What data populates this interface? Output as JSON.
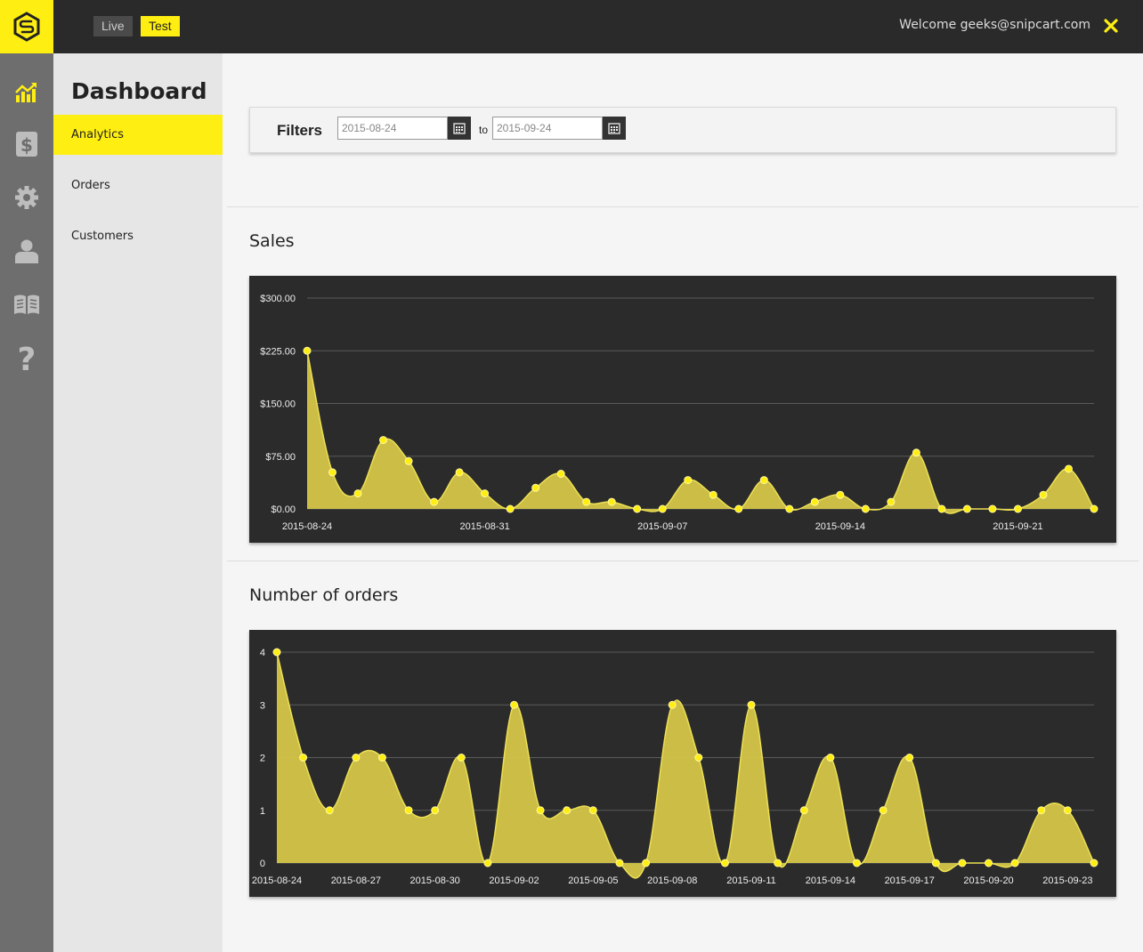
{
  "topbar": {
    "env_live": "Live",
    "env_test": "Test",
    "welcome": "Welcome geeks@snipcart.com"
  },
  "colors": {
    "accent": "#ffee11",
    "dark": "#2a2a2a",
    "sidebar": "#6e6e6e",
    "submenu": "#e6e6e6"
  },
  "nav_icons": [
    "analytics-icon",
    "dollar-icon",
    "gear-icon",
    "user-icon",
    "book-icon",
    "help-icon"
  ],
  "submenu": {
    "title": "Dashboard",
    "items": [
      {
        "label": "Analytics",
        "active": true
      },
      {
        "label": "Orders",
        "active": false
      },
      {
        "label": "Customers",
        "active": false
      }
    ]
  },
  "filters": {
    "label": "Filters",
    "from_value": "2015-08-24",
    "to_label": "to",
    "to_value": "2015-09-24"
  },
  "sales": {
    "title": "Sales",
    "chart_data": {
      "type": "area",
      "x": [
        "2015-08-24",
        "2015-08-25",
        "2015-08-26",
        "2015-08-27",
        "2015-08-28",
        "2015-08-29",
        "2015-08-30",
        "2015-08-31",
        "2015-09-01",
        "2015-09-02",
        "2015-09-03",
        "2015-09-04",
        "2015-09-05",
        "2015-09-06",
        "2015-09-07",
        "2015-09-08",
        "2015-09-09",
        "2015-09-10",
        "2015-09-11",
        "2015-09-12",
        "2015-09-13",
        "2015-09-14",
        "2015-09-15",
        "2015-09-16",
        "2015-09-17",
        "2015-09-18",
        "2015-09-19",
        "2015-09-20",
        "2015-09-21",
        "2015-09-22",
        "2015-09-23",
        "2015-09-24"
      ],
      "values": [
        225,
        52,
        22,
        98,
        68,
        10,
        52,
        22,
        0,
        30,
        50,
        10,
        10,
        0,
        0,
        41,
        20,
        0,
        41,
        0,
        10,
        20,
        0,
        10,
        80,
        0,
        0,
        0,
        0,
        20,
        57,
        0
      ],
      "xticks": [
        "2015-08-24",
        "2015-08-31",
        "2015-09-07",
        "2015-09-14",
        "2015-09-21"
      ],
      "yticks": [
        "$0.00",
        "$75.00",
        "$150.00",
        "$225.00",
        "$300.00"
      ],
      "ylim": [
        0,
        300
      ]
    }
  },
  "orders": {
    "title": "Number of orders",
    "chart_data": {
      "type": "area",
      "x": [
        "2015-08-24",
        "2015-08-25",
        "2015-08-26",
        "2015-08-27",
        "2015-08-28",
        "2015-08-29",
        "2015-08-30",
        "2015-08-31",
        "2015-09-01",
        "2015-09-02",
        "2015-09-03",
        "2015-09-04",
        "2015-09-05",
        "2015-09-06",
        "2015-09-07",
        "2015-09-08",
        "2015-09-09",
        "2015-09-10",
        "2015-09-11",
        "2015-09-12",
        "2015-09-13",
        "2015-09-14",
        "2015-09-15",
        "2015-09-16",
        "2015-09-17",
        "2015-09-18",
        "2015-09-19",
        "2015-09-20",
        "2015-09-21",
        "2015-09-22",
        "2015-09-23",
        "2015-09-24"
      ],
      "values": [
        4,
        2,
        1,
        2,
        2,
        1,
        1,
        2,
        0,
        3,
        1,
        1,
        1,
        0,
        0,
        3,
        2,
        0,
        3,
        0,
        1,
        2,
        0,
        1,
        2,
        0,
        0,
        0,
        0,
        1,
        1,
        0
      ],
      "xticks": [
        "2015-08-24",
        "2015-08-27",
        "2015-08-30",
        "2015-09-02",
        "2015-09-05",
        "2015-09-08",
        "2015-09-11",
        "2015-09-14",
        "2015-09-17",
        "2015-09-20",
        "2015-09-23"
      ],
      "yticks": [
        "0",
        "1",
        "2",
        "3",
        "4"
      ],
      "ylim": [
        0,
        4
      ]
    }
  }
}
